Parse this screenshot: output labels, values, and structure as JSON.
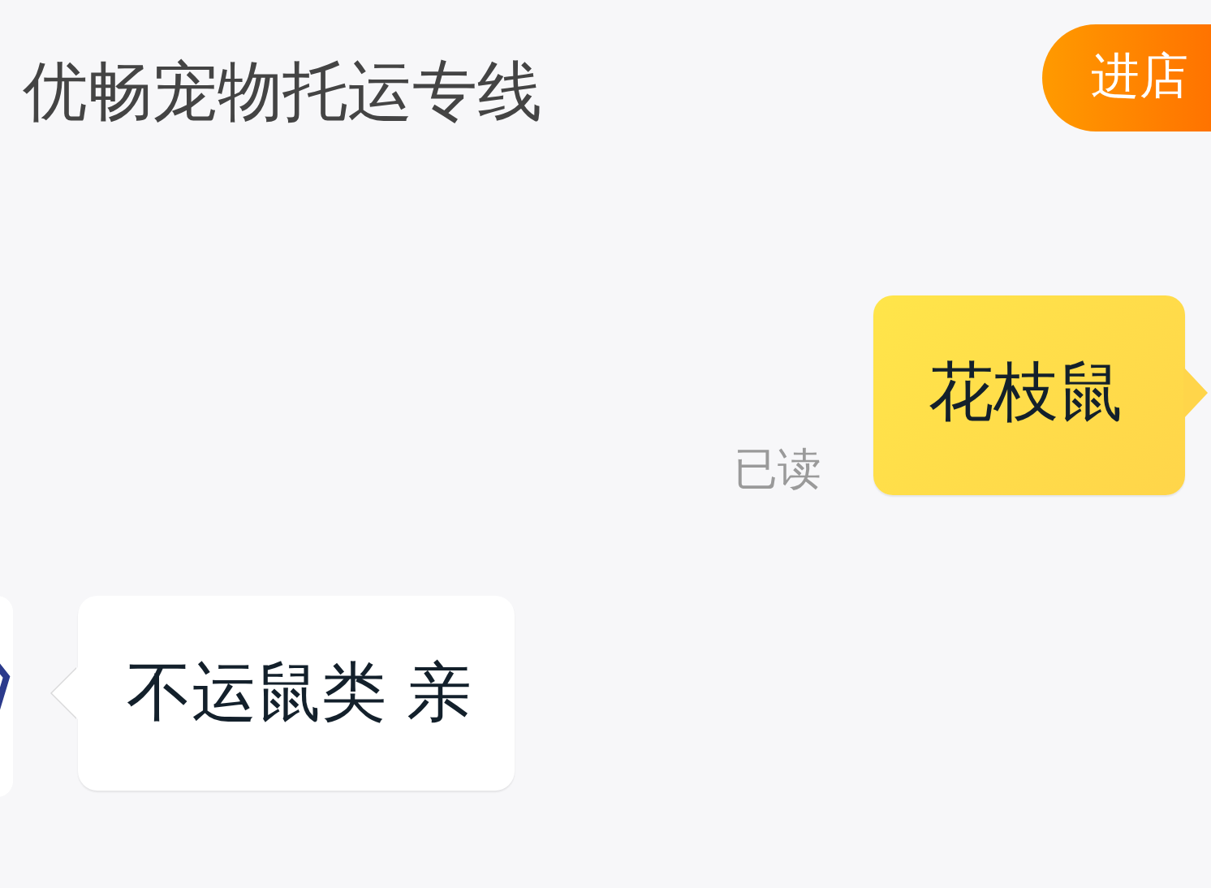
{
  "header": {
    "title": "优畅宠物托运专线",
    "button": "进店"
  },
  "messages": [
    {
      "kind": "outgoing",
      "text": "花枝鼠",
      "status": "已读"
    },
    {
      "kind": "incoming",
      "text": "不运鼠类 亲"
    }
  ]
}
